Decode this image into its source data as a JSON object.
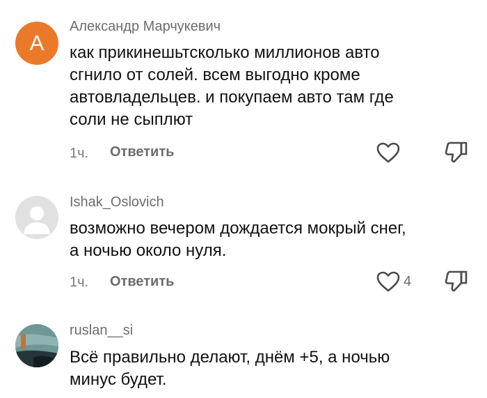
{
  "comments": [
    {
      "author": "Александр Марчукевич",
      "avatar_letter": "A",
      "avatar_color": "#ea7a2a",
      "lines": [
        "как прикинешьтсколько миллионов авто",
        "сгнило от солей. всем выгодно кроме",
        "автовладельцев. и покупаем авто там где",
        "соли не сыплют"
      ],
      "time": "1ч.",
      "reply_label": "Ответить",
      "likes": ""
    },
    {
      "author": "Ishak_Oslovich",
      "avatar_icon": "default-avatar-icon",
      "lines": [
        "возможно вечером дождается мокрый снег,",
        "а ночью около нуля."
      ],
      "time": "1ч.",
      "reply_label": "Ответить",
      "likes": "4"
    },
    {
      "author": "ruslan__si",
      "avatar_icon": "photo-avatar",
      "lines": [
        "Всё правильно делают, днём +5, а ночью",
        "минус будет."
      ]
    }
  ],
  "colors": {
    "text": "#111111",
    "secondary_text": "#6c6c6c",
    "icon_stroke": "#4a4a4a"
  }
}
